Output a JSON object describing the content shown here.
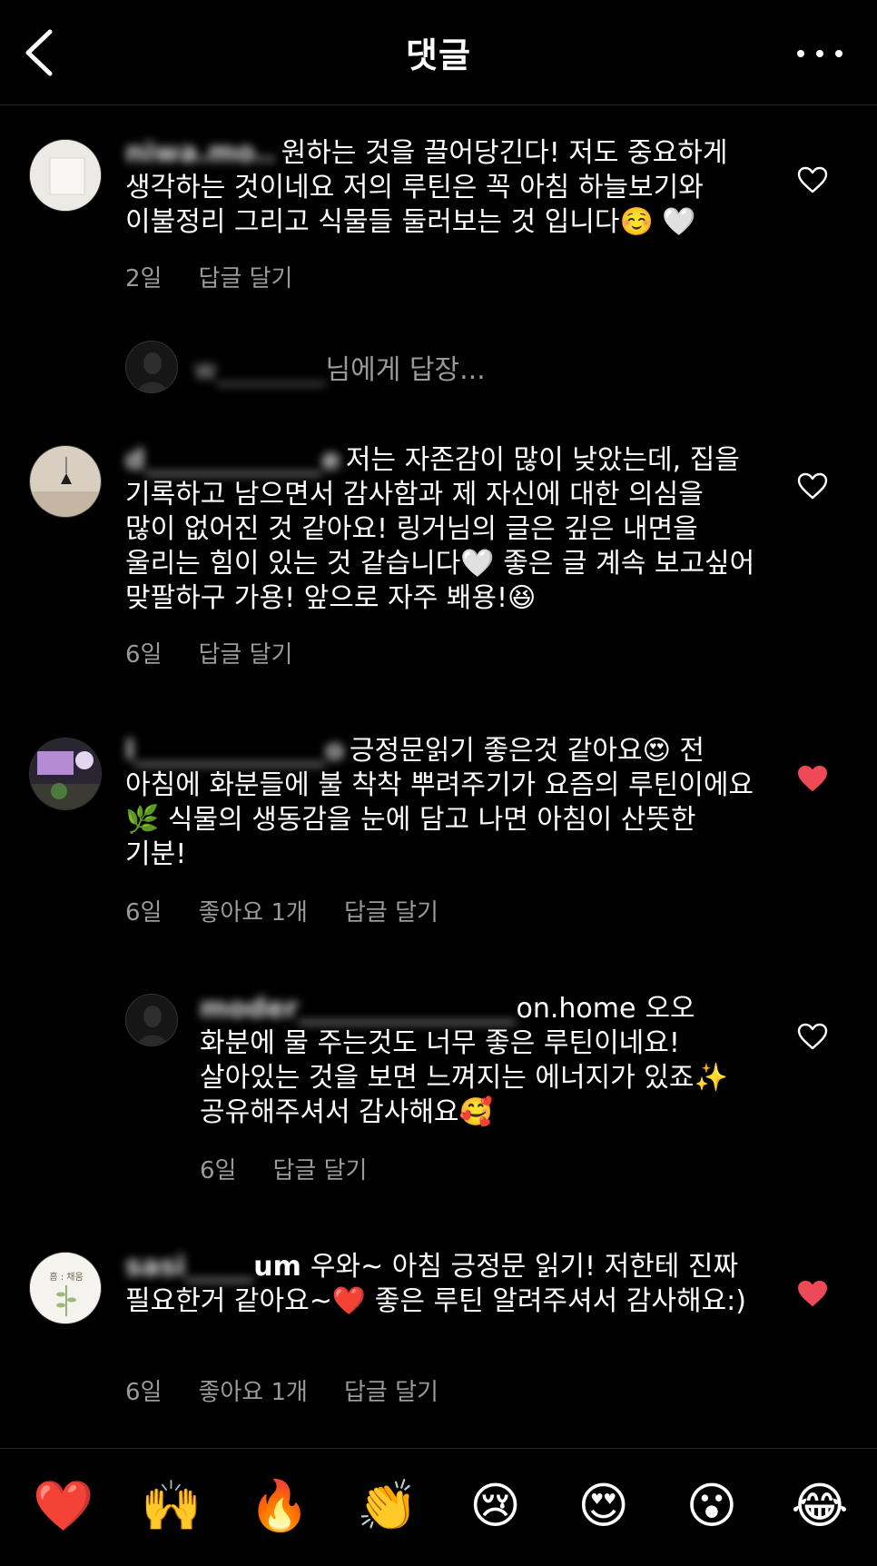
{
  "header": {
    "title": "댓글"
  },
  "comments": [
    {
      "username": "niwa.mo..",
      "text": "원하는 것을 끌어당긴다! 저도 중요하게 생각하는 것이네요 저의 루틴은 꼭 아침 하늘보기와 이불정리 그리고 식물들 둘러보는 것 입니다☺️ 🤍",
      "time": "2일",
      "reply": "답글 달기",
      "liked": false
    },
    {
      "username": "d_____________e",
      "text": "저는 자존감이 많이 낮았는데, 집을 기록하고 남으면서 감사함과 제 자신에 대한 의심을 많이 없어진 것 같아요! 링거님의 글은 깊은 내면을 울리는 힘이 있는 것 같습니다🤍 좋은 글 계속 보고싶어 맞팔하구 가용! 앞으로 자주 봬용!😆",
      "time": "6일",
      "reply": "답글 달기",
      "liked": false
    },
    {
      "username": "l______________o",
      "text": "긍정문읽기 좋은것 같아요😍 전 아침에 화분들에 불 착착 뿌려주기가 요즘의 루틴이에요🌿 식물의 생동감을 눈에 담고 나면 아침이 산뜻한 기분!",
      "time": "6일",
      "likes": "좋아요 1개",
      "reply": "답글 달기",
      "liked": true
    },
    {
      "username_blur": "moder________________",
      "username_visible": "on.home",
      "text": "오오 화분에 물 주는것도 너무 좋은 루틴이네요! 살아있는 것을 보면 느껴지는 에너지가 있죠✨ 공유해주셔서 감사해요🥰",
      "time": "6일",
      "reply": "답글 달기",
      "liked": false
    },
    {
      "username_blur": "sasi_____",
      "username_visible": "um",
      "text": "우와~ 아침 긍정문 읽기! 저한테 진짜 필요한거 같아요~❤️ 좋은 루틴 알려주셔서 감사해요:)",
      "time": "6일",
      "likes": "좋아요 1개",
      "reply": "답글 달기",
      "liked": true
    }
  ],
  "reply_prompt": {
    "name": "w________",
    "suffix": "님에게 답장..."
  },
  "avatar_labels": {
    "c5": "홈 : 채움"
  },
  "emojis": [
    "❤️",
    "🙌",
    "🔥",
    "👏",
    "😢",
    "😍",
    "😮",
    "😂"
  ],
  "colors": {
    "like_red": "#ed4956",
    "muted": "#9a9a9a"
  }
}
